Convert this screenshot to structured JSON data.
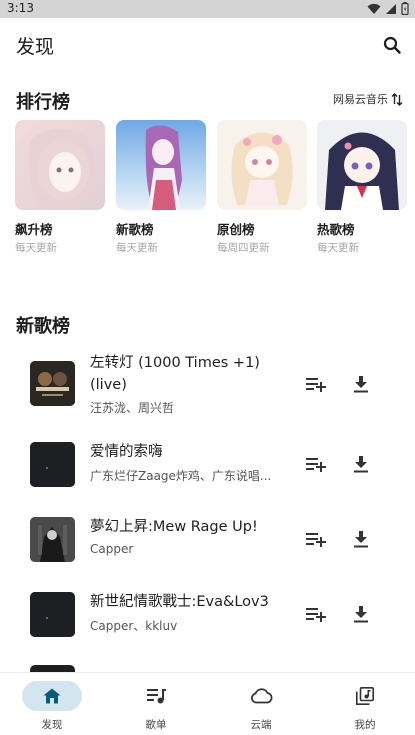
{
  "status_bar": {
    "time": "3:13"
  },
  "app_bar": {
    "title": "发现",
    "search_icon": "search-icon"
  },
  "rankings": {
    "heading": "排行榜",
    "source": "网易云音乐",
    "cards": [
      {
        "name": "飙升榜",
        "update": "每天更新"
      },
      {
        "name": "新歌榜",
        "update": "每天更新"
      },
      {
        "name": "原创榜",
        "update": "每周四更新"
      },
      {
        "name": "热歌榜",
        "update": "每天更新"
      }
    ]
  },
  "new_songs": {
    "heading": "新歌榜",
    "songs": [
      {
        "title": "左转灯 (1000 Times +1) (live)",
        "artist": "汪苏泷、周兴哲"
      },
      {
        "title": "爱情的索嗨",
        "artist": "广东烂仔Zaage炸鸡、广东说唱..."
      },
      {
        "title": "夢幻上昇:Mew Rage Up!",
        "artist": "Capper"
      },
      {
        "title": "新世紀情歌戰士:Eva&Lov3",
        "artist": "Capper、kkluv"
      }
    ]
  },
  "bottom_nav": {
    "items": [
      {
        "label": "发现",
        "icon": "home-icon",
        "active": true
      },
      {
        "label": "歌单",
        "icon": "playlist-icon",
        "active": false
      },
      {
        "label": "云端",
        "icon": "cloud-icon",
        "active": false
      },
      {
        "label": "我的",
        "icon": "library-icon",
        "active": false
      }
    ]
  },
  "colors": {
    "accent": "#0b5a7a",
    "nav_active_bg": "#d3e5ef",
    "muted_text": "#a5a5a5"
  }
}
